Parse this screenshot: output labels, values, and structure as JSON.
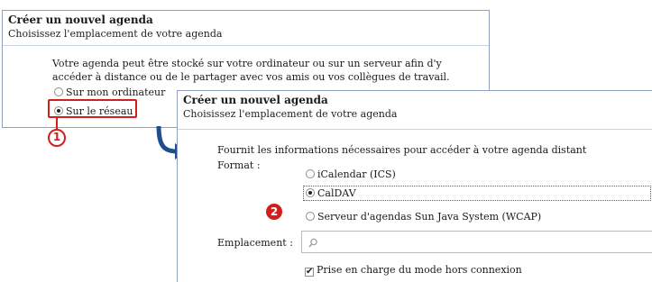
{
  "dialog1": {
    "title": "Créer un nouvel agenda",
    "subtitle": "Choisissez l'emplacement de votre agenda",
    "description_line1": "Votre agenda peut être stocké sur votre ordinateur ou sur un serveur afin d'y",
    "description_line2": "accéder à distance ou de le partager avec vos amis ou vos collègues de travail.",
    "options": [
      {
        "label": "Sur mon ordinateur",
        "selected": false
      },
      {
        "label": "Sur le réseau",
        "selected": true
      }
    ]
  },
  "dialog2": {
    "title": "Créer un nouvel agenda",
    "subtitle": "Choisissez l'emplacement de votre agenda",
    "intro": "Fournit les informations nécessaires pour accéder à votre agenda distant",
    "format_label": "Format :",
    "formats": [
      {
        "label": "iCalendar (ICS)",
        "selected": false
      },
      {
        "label": "CalDAV",
        "selected": true
      },
      {
        "label": "Serveur d'agendas Sun Java System (WCAP)",
        "selected": false
      }
    ],
    "location_label": "Emplacement :",
    "location_value": "",
    "offline_label": "Prise en charge du mode hors connexion",
    "offline_checked": true
  },
  "annotations": {
    "step1": "1",
    "step2": "2"
  },
  "colors": {
    "callout": "#d11f1f",
    "arrow": "#1f4e8c",
    "border": "#8fa3bf"
  },
  "icons": [
    "search-icon",
    "arrow-right-icon",
    "checkmark-icon"
  ]
}
